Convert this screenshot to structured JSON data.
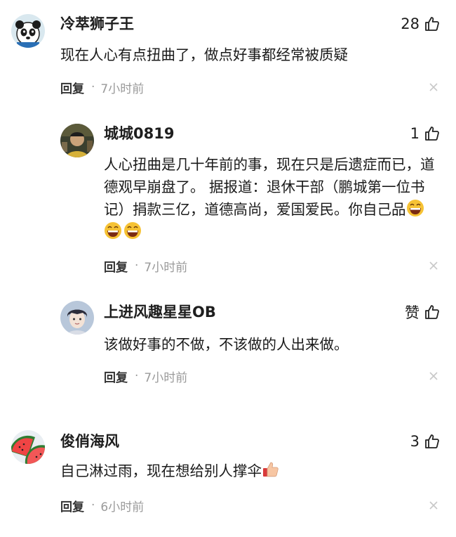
{
  "comments": [
    {
      "username": "冷萃狮子王",
      "likes": "28",
      "text": "现在人心有点扭曲了，做点好事都经常被质疑",
      "reply_label": "回复",
      "separator": "·",
      "time": "7小时前",
      "avatar": "panda-avatar"
    },
    {
      "username": "城城0819",
      "likes": "1",
      "text": "人心扭曲是几十年前的事，现在只是后遗症而已，道德观早崩盘了。 据报道：退休干部（鹏城第一位书记）捐款三亿，道德高尚，爱国爱民。你自己品",
      "emojis": [
        "grin-emoji",
        "grin-emoji",
        "grin-emoji"
      ],
      "reply_label": "回复",
      "separator": "·",
      "time": "7小时前",
      "avatar": "person-avatar"
    },
    {
      "username": "上进风趣星星OB",
      "likes": "赞",
      "text": "该做好事的不做，不该做的人出来做。",
      "reply_label": "回复",
      "separator": "·",
      "time": "7小时前",
      "avatar": "boy-avatar"
    },
    {
      "username": "俊俏海风",
      "likes": "3",
      "text": "自己淋过雨，现在想给别人撑伞",
      "emojis": [
        "thumbs-up-emoji"
      ],
      "reply_label": "回复",
      "separator": "·",
      "time": "6小时前",
      "avatar": "watermelon-avatar"
    }
  ],
  "colors": {
    "text": "#1a1a1a",
    "meta": "#9a9a9a",
    "close": "#c8c8c8",
    "emoji_yellow": "#f6c234"
  },
  "icons": {
    "like": "thumbs-up-outline-icon",
    "close": "close-icon"
  }
}
